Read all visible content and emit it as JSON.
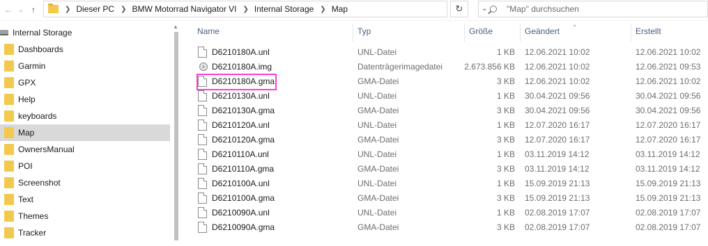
{
  "address_bar": {
    "crumbs": [
      "Dieser PC",
      "BMW Motorrad Navigator VI",
      "Internal Storage",
      "Map"
    ],
    "search_placeholder": "\"Map\" durchsuchen"
  },
  "sidebar": {
    "root_label": "Internal Storage",
    "items": [
      {
        "label": "Dashboards"
      },
      {
        "label": "Garmin"
      },
      {
        "label": "GPX"
      },
      {
        "label": "Help"
      },
      {
        "label": "keyboards"
      },
      {
        "label": "Map",
        "selected": true
      },
      {
        "label": "OwnersManual"
      },
      {
        "label": "POI"
      },
      {
        "label": "Screenshot"
      },
      {
        "label": "Text"
      },
      {
        "label": "Themes"
      },
      {
        "label": "Tracker"
      }
    ]
  },
  "columns": {
    "name": "Name",
    "type": "Typ",
    "size": "Größe",
    "modified": "Geändert",
    "created": "Erstellt"
  },
  "files": [
    {
      "name": "D6210180A.unl",
      "type": "UNL-Datei",
      "size": "1 KB",
      "modified": "12.06.2021 10:02",
      "created": "12.06.2021 10:02",
      "icon": "file-icon"
    },
    {
      "name": "D6210180A.img",
      "type": "Datenträgerimagedatei",
      "size": "2.673.856 KB",
      "modified": "12.06.2021 10:02",
      "created": "12.06.2021 09:53",
      "icon": "disk-image-icon"
    },
    {
      "name": "D6210180A.gma",
      "type": "GMA-Datei",
      "size": "3 KB",
      "modified": "12.06.2021 10:02",
      "created": "12.06.2021 10:02",
      "icon": "file-icon",
      "highlighted": true
    },
    {
      "name": "D6210130A.unl",
      "type": "UNL-Datei",
      "size": "1 KB",
      "modified": "30.04.2021 09:56",
      "created": "30.04.2021 09:56",
      "icon": "file-icon"
    },
    {
      "name": "D6210130A.gma",
      "type": "GMA-Datei",
      "size": "3 KB",
      "modified": "30.04.2021 09:56",
      "created": "30.04.2021 09:56",
      "icon": "file-icon"
    },
    {
      "name": "D6210120A.unl",
      "type": "UNL-Datei",
      "size": "1 KB",
      "modified": "12.07.2020 16:17",
      "created": "12.07.2020 16:17",
      "icon": "file-icon"
    },
    {
      "name": "D6210120A.gma",
      "type": "GMA-Datei",
      "size": "3 KB",
      "modified": "12.07.2020 16:17",
      "created": "12.07.2020 16:17",
      "icon": "file-icon"
    },
    {
      "name": "D6210110A.unl",
      "type": "UNL-Datei",
      "size": "1 KB",
      "modified": "03.11.2019 14:12",
      "created": "03.11.2019 14:12",
      "icon": "file-icon"
    },
    {
      "name": "D6210110A.gma",
      "type": "GMA-Datei",
      "size": "3 KB",
      "modified": "03.11.2019 14:12",
      "created": "03.11.2019 14:12",
      "icon": "file-icon"
    },
    {
      "name": "D6210100A.unl",
      "type": "UNL-Datei",
      "size": "1 KB",
      "modified": "15.09.2019 21:13",
      "created": "15.09.2019 21:13",
      "icon": "file-icon"
    },
    {
      "name": "D6210100A.gma",
      "type": "GMA-Datei",
      "size": "3 KB",
      "modified": "15.09.2019 21:13",
      "created": "15.09.2019 21:13",
      "icon": "file-icon"
    },
    {
      "name": "D6210090A.unl",
      "type": "UNL-Datei",
      "size": "1 KB",
      "modified": "02.08.2019 17:07",
      "created": "02.08.2019 17:07",
      "icon": "file-icon"
    },
    {
      "name": "D6210090A.gma",
      "type": "GMA-Datei",
      "size": "3 KB",
      "modified": "02.08.2019 17:07",
      "created": "02.08.2019 17:07",
      "icon": "file-icon"
    }
  ],
  "colors": {
    "highlight": "#ff3bd6",
    "selected_bg": "#d9d9d9",
    "folder": "#f2c94c",
    "header_text": "#4c607f"
  }
}
